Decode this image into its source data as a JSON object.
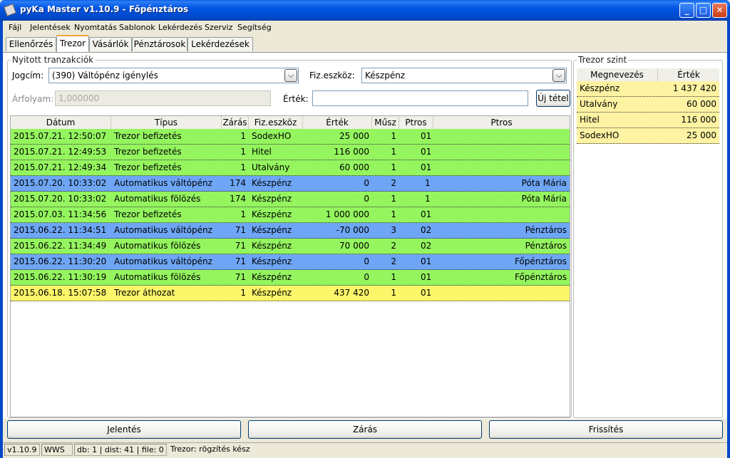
{
  "window": {
    "title": "pyKa Master v1.10.9 - Főpénztáros",
    "minimize": "_",
    "maximize": "□",
    "close": "✕"
  },
  "menu": [
    "Fájl",
    "Jelentések",
    "Nyomtatás",
    "Sablonok",
    "Lekérdezés",
    "Szerviz",
    "Segítség"
  ],
  "tabs": [
    "Ellenőrzés",
    "Trezor",
    "Vásárlók",
    "Pénztárosok",
    "Lekérdezések"
  ],
  "active_tab": "Trezor",
  "open_tx": {
    "group_label": "Nyitott tranzakciók",
    "jogcim_label": "Jogcím:",
    "jogcim_value": "(390) Váltópénz igénylés",
    "fizeszkoz_label": "Fiz.eszköz:",
    "fizeszkoz_value": "Készpénz",
    "arfolyam_label": "Árfolyam:",
    "arfolyam_value": "1,000000",
    "ertek_label": "Érték:",
    "ertek_value": "",
    "new_button": "Új tétel",
    "dropdown_arrow": "⌵"
  },
  "table": {
    "headers": [
      "Dátum",
      "Típus",
      "Zárás",
      "Fiz.eszköz",
      "Érték",
      "Műsz",
      "Ptros",
      "Ptros"
    ],
    "rows": [
      {
        "date": "2015.07.21. 12:50:07",
        "type": "Trezor befizetés",
        "zaras": "1",
        "fiz": "SodexHO",
        "ertek": "25 000",
        "musz": "1",
        "ptros": "01",
        "name": "",
        "color": "#94f55f"
      },
      {
        "date": "2015.07.21. 12:49:53",
        "type": "Trezor befizetés",
        "zaras": "1",
        "fiz": "Hitel",
        "ertek": "116 000",
        "musz": "1",
        "ptros": "01",
        "name": "",
        "color": "#94f55f"
      },
      {
        "date": "2015.07.21. 12:49:34",
        "type": "Trezor befizetés",
        "zaras": "1",
        "fiz": "Utalvány",
        "ertek": "60 000",
        "musz": "1",
        "ptros": "01",
        "name": "",
        "color": "#94f55f"
      },
      {
        "date": "2015.07.20. 10:33:02",
        "type": "Automatikus váltópénz",
        "zaras": "174",
        "fiz": "Készpénz",
        "ertek": "0",
        "musz": "2",
        "ptros": "1",
        "name": "Póta Mária",
        "color": "#6ea6f5"
      },
      {
        "date": "2015.07.20. 10:33:02",
        "type": "Automatikus fölözés",
        "zaras": "174",
        "fiz": "Készpénz",
        "ertek": "0",
        "musz": "1",
        "ptros": "1",
        "name": "Póta Mária",
        "color": "#94f55f"
      },
      {
        "date": "2015.07.03. 11:34:56",
        "type": "Trezor befizetés",
        "zaras": "1",
        "fiz": "Készpénz",
        "ertek": "1 000 000",
        "musz": "1",
        "ptros": "01",
        "name": "",
        "color": "#94f55f"
      },
      {
        "date": "2015.06.22. 11:34:51",
        "type": "Automatikus váltópénz",
        "zaras": "71",
        "fiz": "Készpénz",
        "ertek": "-70 000",
        "musz": "3",
        "ptros": "02",
        "name": "Pénztáros",
        "color": "#6ea6f5"
      },
      {
        "date": "2015.06.22. 11:34:49",
        "type": "Automatikus fölözés",
        "zaras": "71",
        "fiz": "Készpénz",
        "ertek": "70 000",
        "musz": "2",
        "ptros": "02",
        "name": "Pénztáros",
        "color": "#94f55f"
      },
      {
        "date": "2015.06.22. 11:30:20",
        "type": "Automatikus váltópénz",
        "zaras": "71",
        "fiz": "Készpénz",
        "ertek": "0",
        "musz": "2",
        "ptros": "01",
        "name": "Főpénztáros",
        "color": "#6ea6f5"
      },
      {
        "date": "2015.06.22. 11:30:19",
        "type": "Automatikus fölözés",
        "zaras": "71",
        "fiz": "Készpénz",
        "ertek": "0",
        "musz": "1",
        "ptros": "01",
        "name": "Főpénztáros",
        "color": "#94f55f"
      },
      {
        "date": "2015.06.18. 15:07:58",
        "type": "Trezor áthozat",
        "zaras": "1",
        "fiz": "Készpénz",
        "ertek": "437 420",
        "musz": "1",
        "ptros": "01",
        "name": "",
        "color": "#fbf66a"
      }
    ]
  },
  "trezor": {
    "group_label": "Trezor szint",
    "headers": [
      "Megnevezés",
      "Érték"
    ],
    "rows": [
      {
        "name": "Készpénz",
        "value": "1 437 420"
      },
      {
        "name": "Utalvány",
        "value": "60 000"
      },
      {
        "name": "Hitel",
        "value": "116 000"
      },
      {
        "name": "SodexHO",
        "value": "25 000"
      }
    ]
  },
  "buttons": {
    "report": "Jelentés",
    "close": "Zárás",
    "refresh": "Frissítés"
  },
  "status": [
    "v1.10.9",
    "WWS",
    "db: 1 | dist: 41 | file: 0",
    "Trezor: rögzítés kész"
  ]
}
